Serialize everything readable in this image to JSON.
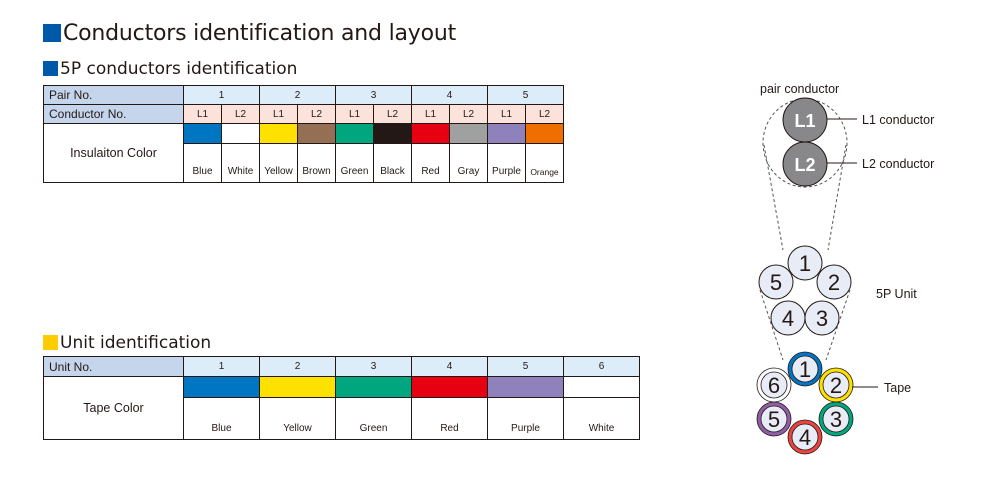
{
  "title": "Conductors identification and layout",
  "title_marker_color": "#0058a9",
  "section1": {
    "heading": "5P conductors identification",
    "marker_color": "#0058a9",
    "row_labels": {
      "pair": "Pair No.",
      "conductor": "Conductor No.",
      "color": "Insulaiton Color"
    },
    "pairs": [
      "1",
      "2",
      "3",
      "4",
      "5"
    ],
    "conductors": [
      {
        "no": "L1",
        "color_name": "Blue",
        "hex": "#0075c2"
      },
      {
        "no": "L2",
        "color_name": "White",
        "hex": "#ffffff"
      },
      {
        "no": "L1",
        "color_name": "Yellow",
        "hex": "#ffe100"
      },
      {
        "no": "L2",
        "color_name": "Brown",
        "hex": "#956f54"
      },
      {
        "no": "L1",
        "color_name": "Green",
        "hex": "#00a77e"
      },
      {
        "no": "L2",
        "color_name": "Black",
        "hex": "#231815"
      },
      {
        "no": "L1",
        "color_name": "Red",
        "hex": "#e60012"
      },
      {
        "no": "L2",
        "color_name": "Gray",
        "hex": "#9fa0a0"
      },
      {
        "no": "L1",
        "color_name": "Purple",
        "hex": "#8f82bc"
      },
      {
        "no": "L2",
        "color_name": "Orange",
        "hex": "#ee6e00"
      }
    ]
  },
  "section2": {
    "heading": "Unit identification",
    "marker_color": "#ffcc00",
    "row_labels": {
      "unit": "Unit No.",
      "color": "Tape Color"
    },
    "units": [
      {
        "no": "1",
        "color_name": "Blue",
        "hex": "#0075c2"
      },
      {
        "no": "2",
        "color_name": "Yellow",
        "hex": "#ffe100"
      },
      {
        "no": "3",
        "color_name": "Green",
        "hex": "#00a77e"
      },
      {
        "no": "4",
        "color_name": "Red",
        "hex": "#e60012"
      },
      {
        "no": "5",
        "color_name": "Purple",
        "hex": "#8f82bc"
      },
      {
        "no": "6",
        "color_name": "White",
        "hex": "#ffffff"
      }
    ]
  },
  "diagram": {
    "pair_label": "pair  conductor",
    "l1_text": "L1",
    "l2_text": "L2",
    "l1_label": "L1 conductor",
    "l2_label": "L2 conductor",
    "unit_label": "5P Unit",
    "tape_label": "Tape",
    "unit_numbers": [
      "1",
      "2",
      "3",
      "4",
      "5"
    ],
    "cable_numbers": [
      "1",
      "2",
      "3",
      "4",
      "5",
      "6"
    ],
    "tape_colors": [
      "#0075c2",
      "#ffe100",
      "#00a77e",
      "#e9443f",
      "#8f5ea5",
      "#ffffff"
    ]
  }
}
